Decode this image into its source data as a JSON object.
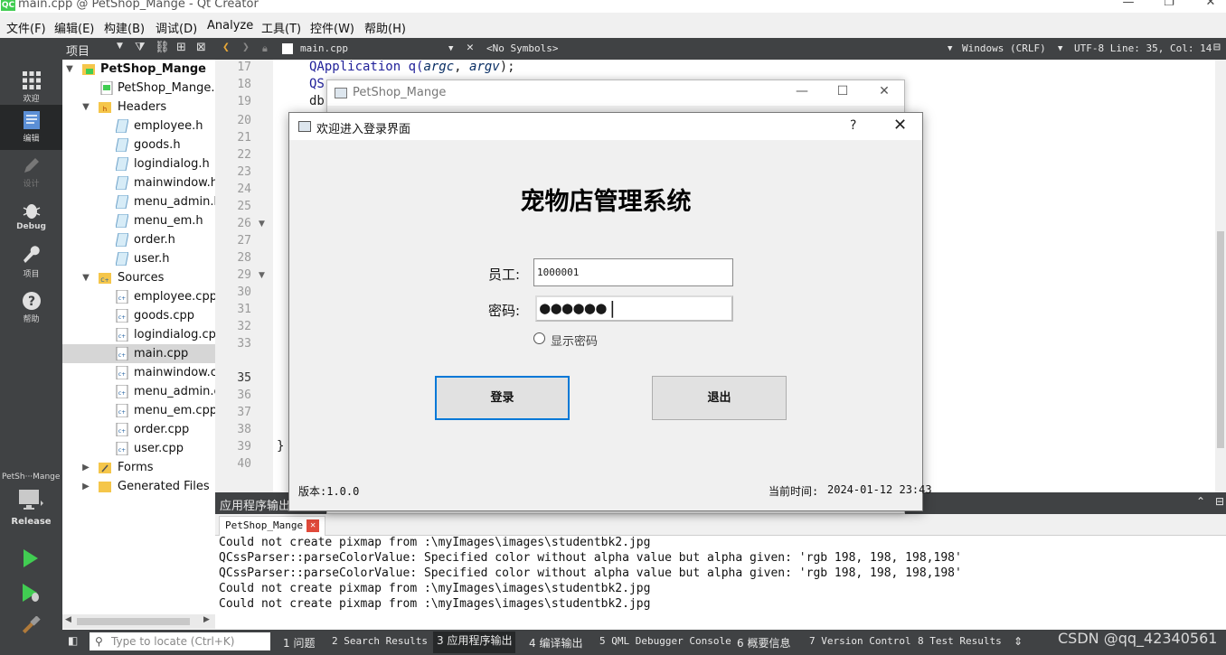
{
  "window": {
    "title": "main.cpp @ PetShop_Mange - Qt Creator",
    "controls": [
      "—",
      "❐",
      "✕"
    ]
  },
  "menu": [
    "文件(F)",
    "编辑(E)",
    "构建(B)",
    "调试(D)",
    "Analyze",
    "工具(T)",
    "控件(W)",
    "帮助(H)"
  ],
  "modes": {
    "welcome": "欢迎",
    "edit": "编辑",
    "design": "设计",
    "debug": "Debug",
    "projects": "项目",
    "help": "帮助",
    "kit": "PetSh···Mange",
    "build_config": "Release"
  },
  "project_panel": {
    "selector": "项目",
    "tree": [
      "PetShop_Mange",
      "PetShop_Mange.pro",
      "Headers",
      "employee.h",
      "goods.h",
      "logindialog.h",
      "mainwindow.h",
      "menu_admin.h",
      "menu_em.h",
      "order.h",
      "user.h",
      "Sources",
      "employee.cpp",
      "goods.cpp",
      "logindialog.cpp",
      "main.cpp",
      "mainwindow.cpp",
      "menu_admin.cpp",
      "menu_em.cpp",
      "order.cpp",
      "user.cpp",
      "Forms",
      "Generated Files"
    ]
  },
  "editor": {
    "file": "main.cpp",
    "symbols": "<No Symbols>",
    "line_ending": "Windows (CRLF)",
    "status": "UTF-8 Line: 35, Col: 14",
    "line_numbers": [
      "17",
      "18",
      "19",
      "20",
      "21",
      "22",
      "23",
      "24",
      "25",
      "26",
      "27",
      "28",
      "29",
      "30",
      "31",
      "32",
      "33",
      "35",
      "36",
      "37",
      "38",
      "39",
      "40"
    ],
    "code": {
      "l17_pre": "QApplication q(",
      "l17_arg1": "argc",
      "l17_mid": ", ",
      "l17_arg2": "argv",
      "l17_post": ");",
      "l18": "QS",
      "l19": "db",
      "l39": "}"
    }
  },
  "background_window": {
    "title": "PetShop_Mange"
  },
  "dialog": {
    "title": "欢迎进入登录界面",
    "help": "?",
    "close": "✕",
    "heading": "宠物店管理系统",
    "employee_label": "员工:",
    "employee_value": "1000001",
    "password_label": "密码:",
    "password_mask": "●●●●●●|",
    "show_password": "显示密码",
    "login_button": "登录",
    "exit_button": "退出",
    "version": "版本:1.0.0",
    "time_label": "当前时间:",
    "time_value": "2024-01-12 23:43"
  },
  "output": {
    "header": "应用程序输出",
    "tab": "PetShop_Mange",
    "lines": [
      "Could not create pixmap from :\\myImages\\images\\studentbk2.jpg",
      "QCssParser::parseColorValue: Specified color without alpha value but alpha given: 'rgb 198, 198, 198,198'",
      "QCssParser::parseColorValue: Specified color without alpha value but alpha given: 'rgb 198, 198, 198,198'",
      "Could not create pixmap from :\\myImages\\images\\studentbk2.jpg",
      "Could not create pixmap from :\\myImages\\images\\studentbk2.jpg"
    ]
  },
  "statusbar": {
    "locator_placeholder": "Type to locate (Ctrl+K)",
    "panes": [
      "1 问题",
      "2 Search Results",
      "3 应用程序输出",
      "4 编译输出",
      "5 QML Debugger Console",
      "6 概要信息",
      "7 Version Control",
      "8 Test Results"
    ]
  },
  "watermark": "CSDN @qq_42340561",
  "colors": {
    "ide_dark": "#404244",
    "qt_green": "#41cd52",
    "keyword": "#1f1f99",
    "param": "#092e64",
    "default_button_border": "#0078d7"
  }
}
